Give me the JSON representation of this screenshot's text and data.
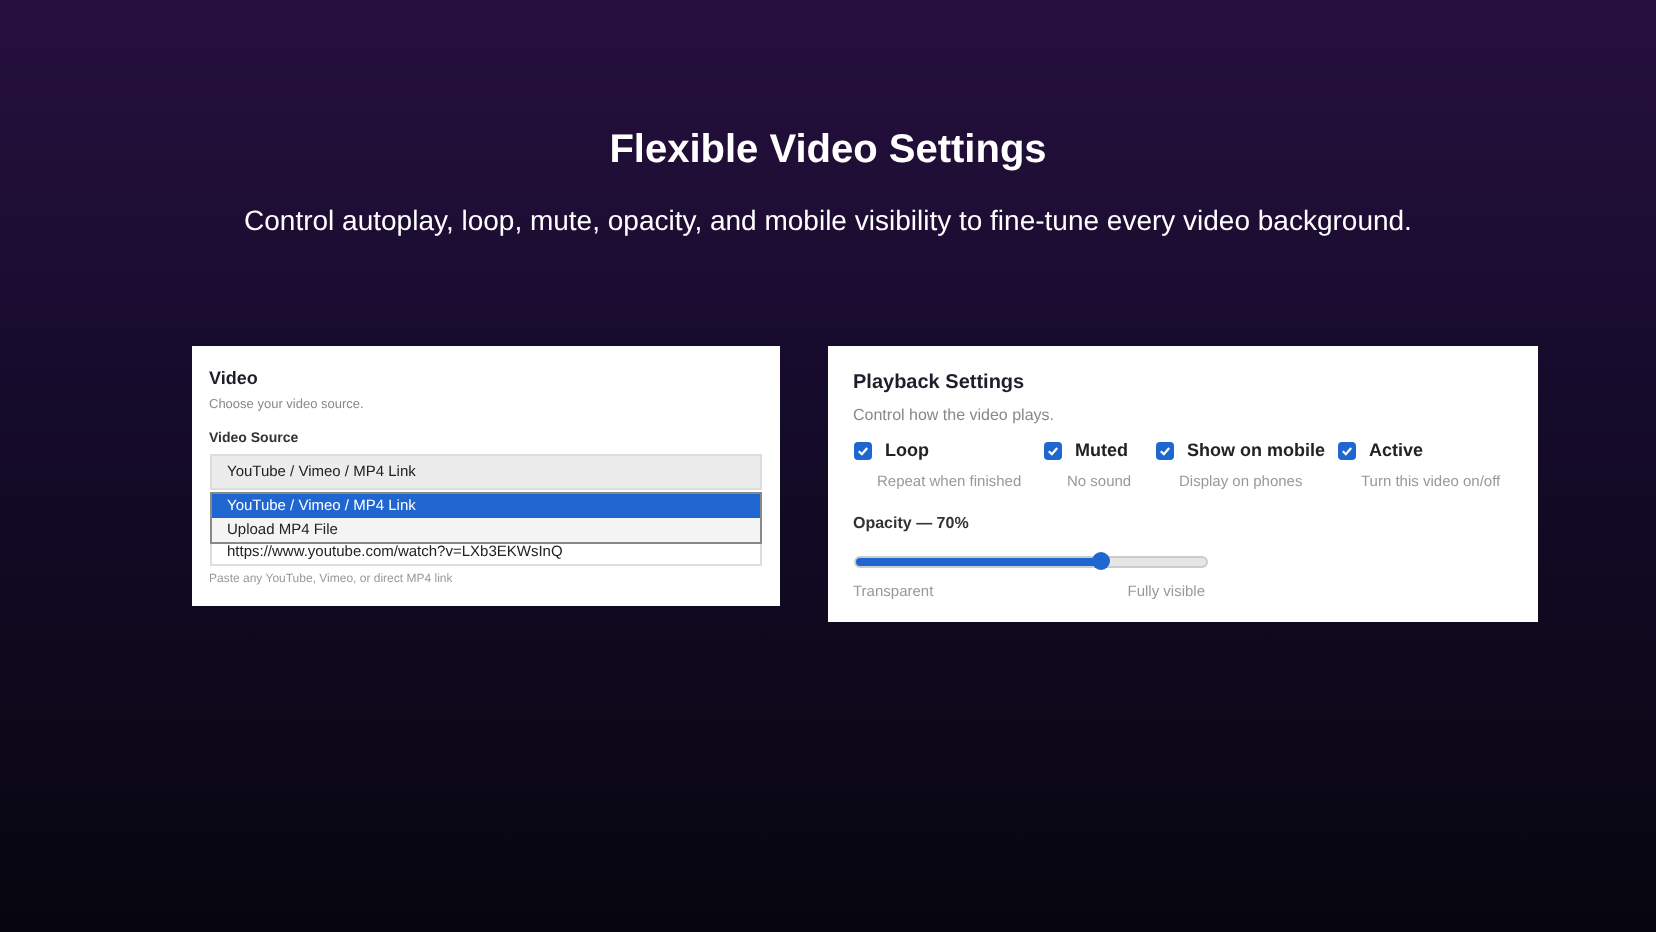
{
  "heading": "Flexible Video Settings",
  "subheading": "Control autoplay, loop, mute, opacity, and mobile visibility to fine-tune every video background.",
  "video_card": {
    "title": "Video",
    "description": "Choose your video source.",
    "source_label": "Video Source",
    "select_value": "YouTube / Vimeo / MP4 Link",
    "options": [
      {
        "label": "YouTube / Vimeo / MP4 Link",
        "selected": true
      },
      {
        "label": "Upload MP4 File",
        "selected": false
      }
    ],
    "url_value": "https://www.youtube.com/watch?v=LXb3EKWsInQ",
    "hint": "Paste any YouTube, Vimeo, or direct MP4 link"
  },
  "playback_card": {
    "title": "Playback Settings",
    "description": "Control how the video plays.",
    "toggles": [
      {
        "label": "Loop",
        "description": "Repeat when finished",
        "checked": true
      },
      {
        "label": "Muted",
        "description": "No sound",
        "checked": true
      },
      {
        "label": "Show on mobile",
        "description": "Display on phones",
        "checked": true
      },
      {
        "label": "Active",
        "description": "Turn this video on/off",
        "checked": true
      }
    ],
    "opacity": {
      "label": "Opacity — 70%",
      "level": 0.7,
      "min_label": "Transparent",
      "max_label": "Fully visible"
    }
  }
}
